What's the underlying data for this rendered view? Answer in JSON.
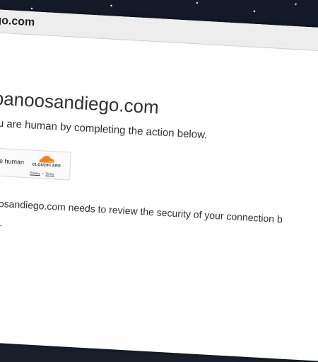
{
  "browser": {
    "address": "iego.com"
  },
  "page": {
    "heading": "itanbanoosandiego.com",
    "subtitle": "you are human by completing the action below.",
    "captcha": {
      "label": "y you are human",
      "brand": "CLOUDFLARE",
      "privacy_link": "Privacy",
      "separator": "•",
      "terms_link": "Terms",
      "brand_color": "#f38020"
    },
    "body_line1": "anoosandiego.com needs to review the security of your connection b",
    "body_line2": "ding."
  }
}
